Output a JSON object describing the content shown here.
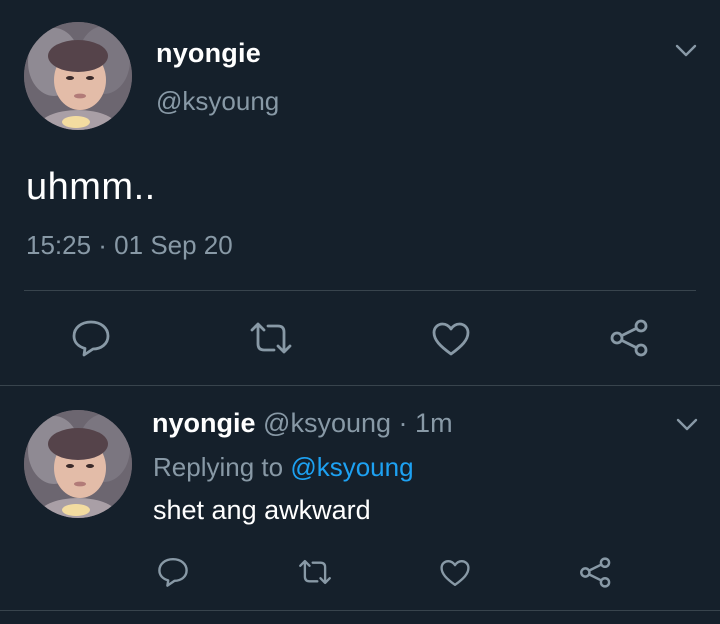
{
  "main_tweet": {
    "display_name": "nyongie",
    "handle": "@ksyoung",
    "text": "uhmm..",
    "timestamp": "15:25 · 01 Sep 20",
    "menu_icon": "chevron-down-icon",
    "actions": [
      "reply-icon",
      "retweet-icon",
      "like-icon",
      "share-icon"
    ]
  },
  "reply": {
    "display_name": "nyongie",
    "handle": "@ksyoung",
    "separator": "·",
    "time_ago": "1m",
    "replying_prefix": "Replying to",
    "replying_to": "@ksyoung",
    "text": "shet ang awkward",
    "menu_icon": "chevron-down-icon",
    "actions": [
      "reply-icon",
      "retweet-icon",
      "like-icon",
      "share-icon"
    ]
  },
  "colors": {
    "background": "#15202b",
    "primary_text": "#ffffff",
    "secondary_text": "#8899a6",
    "accent": "#1da1f2",
    "divider": "#38444d"
  }
}
